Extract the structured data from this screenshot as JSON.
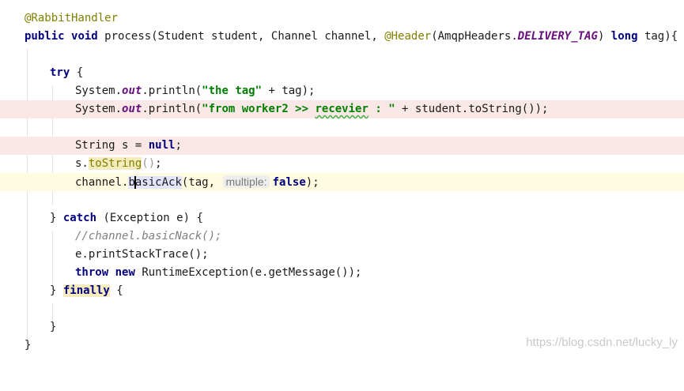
{
  "code": {
    "l1": {
      "annotation": "@RabbitHandler"
    },
    "l2": {
      "kw1": "public",
      "kw2": "void",
      "pre": "process(Student student, Channel channel, ",
      "ann": "@Header",
      "mid": "(AmqpHeaders.",
      "field": "DELIVERY_TAG",
      "post": ") ",
      "kw3": "long",
      "end": " tag){"
    },
    "l4": {
      "kw": "try",
      "rest": " {"
    },
    "l5": {
      "pre": "System.",
      "field": "out",
      "mid": ".println(",
      "str": "\"the tag\"",
      "post": " + tag);"
    },
    "l6": {
      "pre": "System.",
      "field": "out",
      "mid": ".println(",
      "str_a": "\"from worker2 >> ",
      "str_typo": "recevier",
      "str_b": " : \"",
      "post": " + student.toString());"
    },
    "l8": {
      "pre": "String s = ",
      "kw": "null",
      "post": ";"
    },
    "l9": {
      "pre": "s.",
      "warn": "toString",
      "paren": "()",
      "post": ";"
    },
    "l10": {
      "pre": "channel.",
      "ref_a": "b",
      "ref_b": "asicAck",
      "mid": "(tag, ",
      "hint": "multiple:",
      "kw": "false",
      "post": ");"
    },
    "l12": {
      "pre": "} ",
      "kw": "catch",
      "post": " (Exception e) {"
    },
    "l13": {
      "comment": "//channel.basicNack();"
    },
    "l14": {
      "code": "e.printStackTrace();"
    },
    "l15": {
      "kw1": "throw",
      "kw2": "new",
      "post": " RuntimeException(e.getMessage());"
    },
    "l16": {
      "pre": "} ",
      "kw": "finally",
      "post": " {"
    },
    "l18": {
      "code": "}"
    },
    "l19": {
      "code": "}"
    }
  },
  "watermark": "https://blog.csdn.net/lucky_ly",
  "colors": {
    "keyword": "#000080",
    "annotation": "#808000",
    "string": "#008000",
    "static_field": "#660e7a",
    "comment": "#808080",
    "error_line": "#f9e8e6",
    "current_line": "#fffbe0"
  }
}
